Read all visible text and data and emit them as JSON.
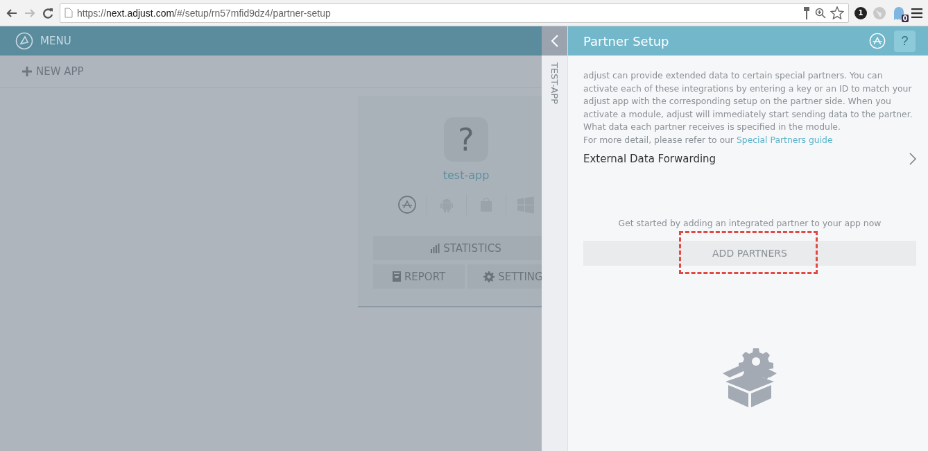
{
  "browser": {
    "url_prefix": "https://",
    "url_host": "next.adjust.com",
    "url_path": "/#/setup/rn57mfid9dz4/partner-setup",
    "extension_badge": "1",
    "ghost_count": "0"
  },
  "sidebar": {
    "menu_label": "MENU",
    "new_app_label": "NEW APP"
  },
  "app_card": {
    "icon_glyph": "?",
    "name": "test-app",
    "platforms": [
      {
        "kind": "appstore",
        "selected": true
      },
      {
        "kind": "android",
        "selected": false
      },
      {
        "kind": "winstore",
        "selected": false
      },
      {
        "kind": "windows",
        "selected": false
      }
    ],
    "buttons": [
      {
        "kind": "statistics",
        "label": "STATISTICS"
      },
      {
        "kind": "report",
        "label": "REPORT"
      },
      {
        "kind": "settings",
        "label": "SETTING"
      }
    ]
  },
  "side_tab": {
    "label": "TEST-APP"
  },
  "panel": {
    "title": "Partner Setup",
    "help_glyph": "?",
    "description": "adjust can provide extended data to certain special partners. You can activate each of these integrations by entering a key or an ID to match your adjust app with the corresponding setup on the partner side. When you activate a module, adjust will immediately start sending data to the partner. What data each partner receives is specified in the module.",
    "detail_text": "For more detail, please refer to our",
    "detail_link": "Special Partners guide",
    "section": "External Data Forwarding",
    "empty_text": "Get started by adding an integrated partner to your app now",
    "add_button": {
      "label": "ADD PARTNERS",
      "highlighted": true
    }
  }
}
